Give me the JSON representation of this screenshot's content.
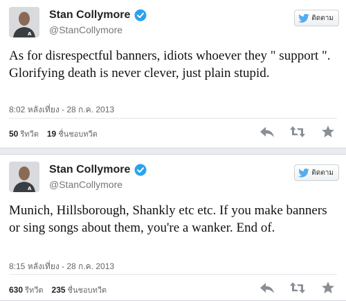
{
  "tweets": [
    {
      "name": "Stan Collymore",
      "handle": "@StanCollymore",
      "follow_label": "ติดตาม",
      "text": "As for disrespectful banners, idiots whoever they \" support \". Glorifying death is never clever, just plain stupid.",
      "time": "8:02 หลังเที่ยง - 28 ก.ค. 2013",
      "retweets": "50",
      "retweets_label": "รีทวีต",
      "favorites": "19",
      "favorites_label": "ชื่นชอบทวีต"
    },
    {
      "name": "Stan Collymore",
      "handle": "@StanCollymore",
      "follow_label": "ติดตาม",
      "text": "Munich, Hillsborough, Shankly etc etc. If you make banners or sing songs about them, you're a wanker. End of.",
      "time": "8:15 หลังเที่ยง - 28 ก.ค. 2013",
      "retweets": "630",
      "retweets_label": "รีทวีต",
      "favorites": "235",
      "favorites_label": "ชื่นชอบทวีต"
    }
  ],
  "icons": {
    "verified": "verified-badge-icon",
    "bird": "twitter-bird-icon",
    "reply": "reply-icon",
    "retweet": "retweet-icon",
    "favorite": "star-icon"
  },
  "colors": {
    "verified": "#2aa3ef",
    "bird": "#55acee",
    "action": "#8a8f94",
    "name": "#222222",
    "muted": "#777777"
  }
}
